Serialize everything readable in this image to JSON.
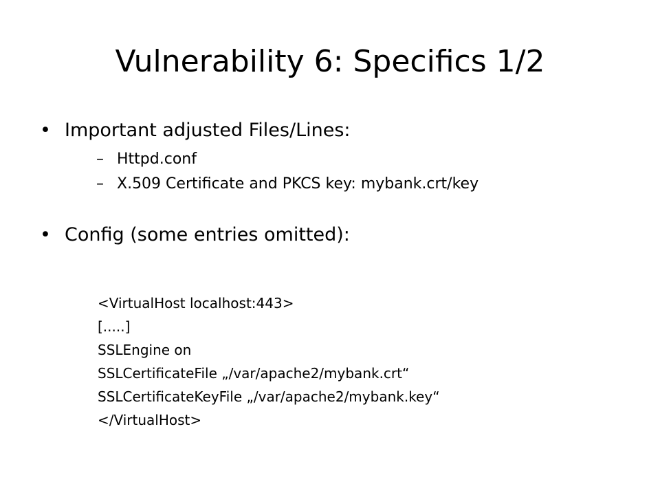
{
  "slide": {
    "title": "Vulnerability 6: Specifics 1/2",
    "bullet_glyph": "•",
    "dash_glyph": "–",
    "bullets": [
      {
        "text": "Important adjusted Files/Lines:",
        "sub_items": [
          "Httpd.conf",
          "X.509 Certificate and PKCS key: mybank.crt/key"
        ]
      },
      {
        "text": "Config (some entries omitted):"
      }
    ],
    "config_lines": [
      "<VirtualHost localhost:443>",
      "[.....]",
      "SSLEngine on",
      "SSLCertificateFile „/var/apache2/mybank.crt“",
      "SSLCertificateKeyFile „/var/apache2/mybank.key“",
      "</VirtualHost>"
    ]
  }
}
